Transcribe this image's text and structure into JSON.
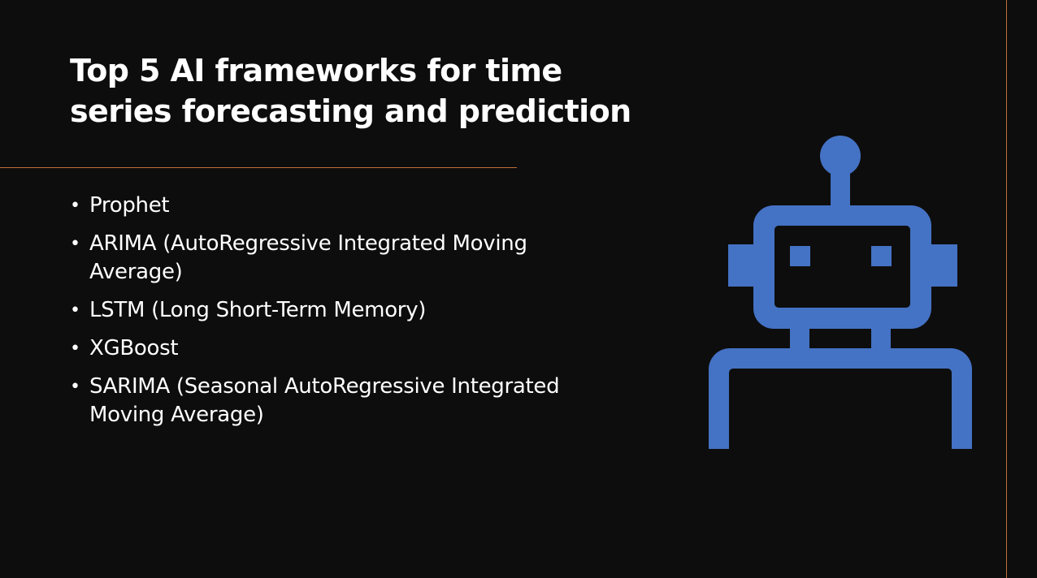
{
  "slide": {
    "title": "Top 5 AI frameworks for time series forecasting and prediction",
    "bullets": [
      "Prophet",
      "ARIMA (AutoRegressive Integrated Moving Average)",
      "LSTM (Long Short-Term Memory)",
      "XGBoost",
      "SARIMA (Seasonal AutoRegressive Integrated Moving Average)"
    ],
    "bullet_symbol": "•",
    "icon": "robot-icon"
  },
  "colors": {
    "background": "#0d0d0d",
    "text": "#ffffff",
    "accent": "#c0703a",
    "icon": "#4472c4"
  }
}
